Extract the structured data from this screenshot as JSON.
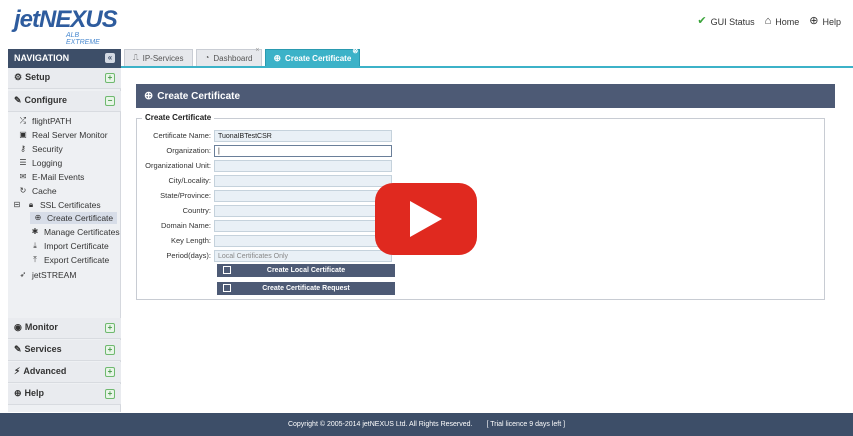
{
  "header": {
    "logo_main": "jetNEXUS",
    "logo_sub": "ALB EXTREME",
    "links": [
      {
        "label": "GUI Status",
        "icon": "check-circle-icon"
      },
      {
        "label": "Home",
        "icon": "home-icon"
      },
      {
        "label": "Help",
        "icon": "lifebuoy-icon"
      }
    ]
  },
  "nav": {
    "title": "NAVIGATION",
    "collapse_glyph": "«",
    "sections": [
      {
        "label": "Setup",
        "toggle": "+"
      },
      {
        "label": "Configure",
        "toggle": "−"
      },
      {
        "label": "Monitor",
        "toggle": "+"
      },
      {
        "label": "Services",
        "toggle": "+"
      },
      {
        "label": "Advanced",
        "toggle": "+"
      },
      {
        "label": "Help",
        "toggle": "+"
      }
    ],
    "items": [
      "flightPATH",
      "Real Server Monitor",
      "Security",
      "Logging",
      "E-Mail Events",
      "Cache",
      "SSL Certificates",
      "Create Certificate",
      "Manage Certificates",
      "Import Certificate",
      "Export Certificate",
      "jetSTREAM"
    ]
  },
  "tabs": [
    {
      "label": "IP-Services"
    },
    {
      "label": "Dashboard"
    },
    {
      "label": "Create Certificate"
    }
  ],
  "panel": {
    "title": "Create Certificate",
    "legend": "Create Certificate"
  },
  "form": [
    {
      "label": "Certificate Name:",
      "value": "TuonaIBTestCSR"
    },
    {
      "label": "Organization:",
      "value": "|"
    },
    {
      "label": "Organizational Unit:",
      "value": ""
    },
    {
      "label": "City/Locality:",
      "value": ""
    },
    {
      "label": "State/Province:",
      "value": ""
    },
    {
      "label": "Country:",
      "value": ""
    },
    {
      "label": "Domain Name:",
      "value": ""
    },
    {
      "label": "Key Length:",
      "value": ""
    },
    {
      "label": "Period(days):",
      "value": "Local Certificates Only"
    }
  ],
  "buttons": {
    "create_local": "Create Local Certificate",
    "create_request": "Create Certificate Request"
  },
  "footer": {
    "copyright": "Copyright © 2005-2014 jetNEXUS Ltd. All Rights Reserved.",
    "licence": "[ Trial licence 9 days left ]"
  },
  "colors": {
    "nav_dark": "#3d4e68",
    "tab_active": "#3cb2c8",
    "play_red": "#e0291f"
  }
}
